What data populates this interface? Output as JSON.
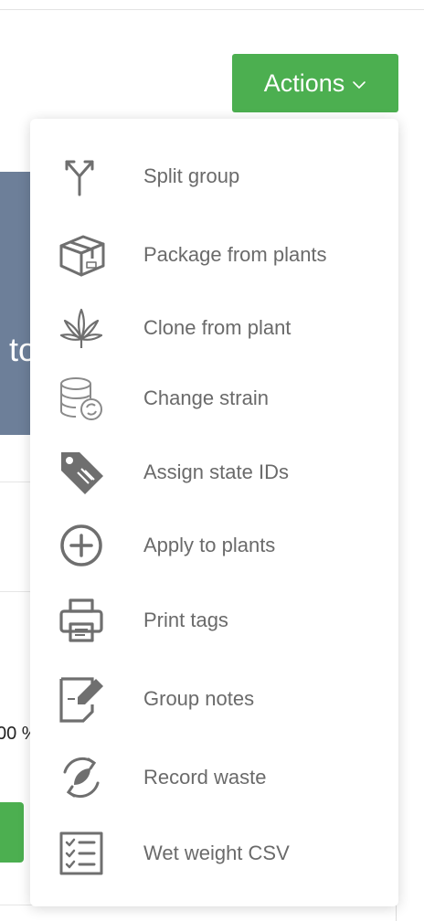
{
  "actions_button": {
    "label": "Actions",
    "icon": "chevron-down-icon"
  },
  "background": {
    "card_text": "to",
    "percent_text": "00 %"
  },
  "menu": {
    "items": [
      {
        "label": "Split group",
        "icon": "split-arrow-icon"
      },
      {
        "label": "Package from plants",
        "icon": "package-box-icon"
      },
      {
        "label": "Clone from plant",
        "icon": "cannabis-leaf-icon"
      },
      {
        "label": "Change strain",
        "icon": "database-refresh-icon"
      },
      {
        "label": "Assign state IDs",
        "icon": "tag-icon"
      },
      {
        "label": "Apply to plants",
        "icon": "plus-circle-icon"
      },
      {
        "label": "Print tags",
        "icon": "printer-icon"
      },
      {
        "label": "Group notes",
        "icon": "note-edit-icon"
      },
      {
        "label": "Record waste",
        "icon": "recycle-leaf-icon"
      },
      {
        "label": "Wet weight CSV",
        "icon": "checklist-icon"
      }
    ]
  }
}
